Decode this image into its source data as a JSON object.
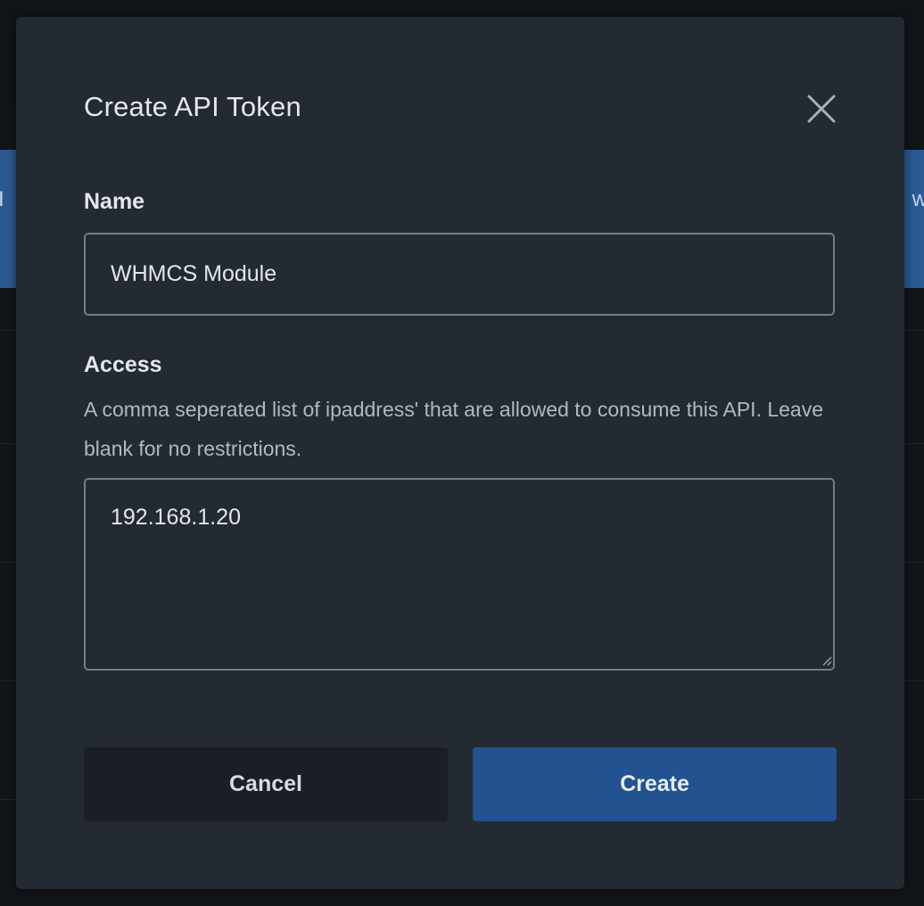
{
  "background": {
    "band_left_text": "I",
    "band_right_text": "w"
  },
  "modal": {
    "title": "Create API Token",
    "close_icon": "close-icon"
  },
  "form": {
    "name": {
      "label": "Name",
      "value": "WHMCS Module"
    },
    "access": {
      "label": "Access",
      "help": "A comma seperated list of ipaddress' that are allowed to consume this API. Leave blank for no restrictions.",
      "value": "192.168.1.20"
    }
  },
  "actions": {
    "cancel_label": "Cancel",
    "create_label": "Create"
  },
  "colors": {
    "modal_bg": "#242a32",
    "primary": "#22528f",
    "secondary": "#1b1f25",
    "backdrop": "#111418"
  }
}
